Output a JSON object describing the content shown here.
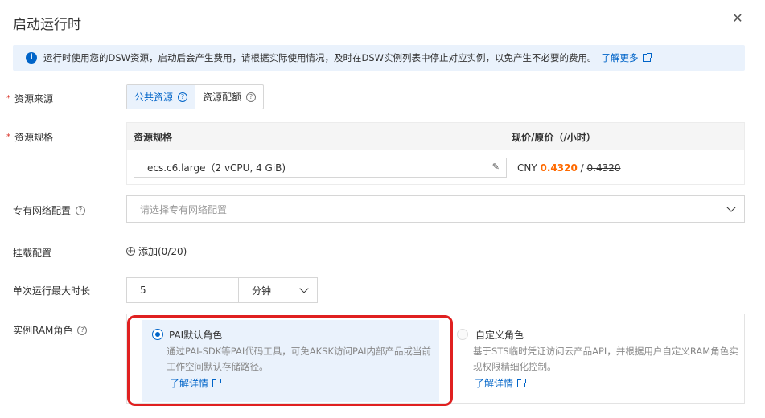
{
  "dialog": {
    "title": "启动运行时"
  },
  "alert": {
    "text": "运行时使用您的DSW资源，启动后会产生费用，请根据实际使用情况，及时在DSW实例列表中停止对应实例，以免产生不必要的费用。",
    "link": "了解更多"
  },
  "resource_source": {
    "label": "资源来源",
    "options": [
      "公共资源",
      "资源配额"
    ],
    "selected": "公共资源"
  },
  "resource_spec": {
    "label": "资源规格",
    "col_spec": "资源规格",
    "col_price": "现价/原价（/小时）",
    "value": "ecs.c6.large（2 vCPU, 4 GiB)",
    "currency": "CNY",
    "price_now": "0.4320",
    "price_sep": "/",
    "price_orig": "0.4320"
  },
  "vpc": {
    "label": "专有网络配置",
    "placeholder": "请选择专有网络配置"
  },
  "mount": {
    "label": "挂载配置",
    "add_text": "添加(0/20)"
  },
  "max_duration": {
    "label": "单次运行最大时长",
    "value": "5",
    "unit": "分钟"
  },
  "ram_role": {
    "label": "实例RAM角色",
    "options": [
      {
        "title": "PAI默认角色",
        "desc": "通过PAI-SDK等PAI代码工具，可免AKSK访问PAI内部产品或当前工作空间默认存储路径。",
        "link": "了解详情",
        "selected": true
      },
      {
        "title": "自定义角色",
        "desc": "基于STS临时凭证访问云产品API，并根据用户自定义RAM角色实现权限精细化控制。",
        "link": "了解详情",
        "selected": false
      }
    ]
  },
  "colors": {
    "accent": "#0064c8",
    "price": "#ff6a00",
    "required": "#d93026",
    "highlight": "#e02020"
  }
}
